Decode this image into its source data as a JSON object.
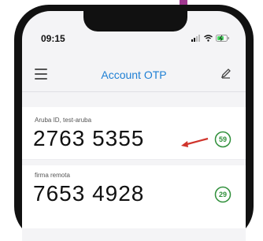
{
  "status_bar": {
    "time": "09:15"
  },
  "header": {
    "title": "Account OTP"
  },
  "accounts": [
    {
      "label": "Aruba ID, test-aruba",
      "code": "2763 5355",
      "seconds_left": "59"
    },
    {
      "label": "firma remota",
      "code": "7653 4928",
      "seconds_left": "29"
    }
  ],
  "colors": {
    "accent": "#1e7fd4",
    "timer": "#2f8f3a",
    "annotation_arrow": "#d0342c"
  }
}
